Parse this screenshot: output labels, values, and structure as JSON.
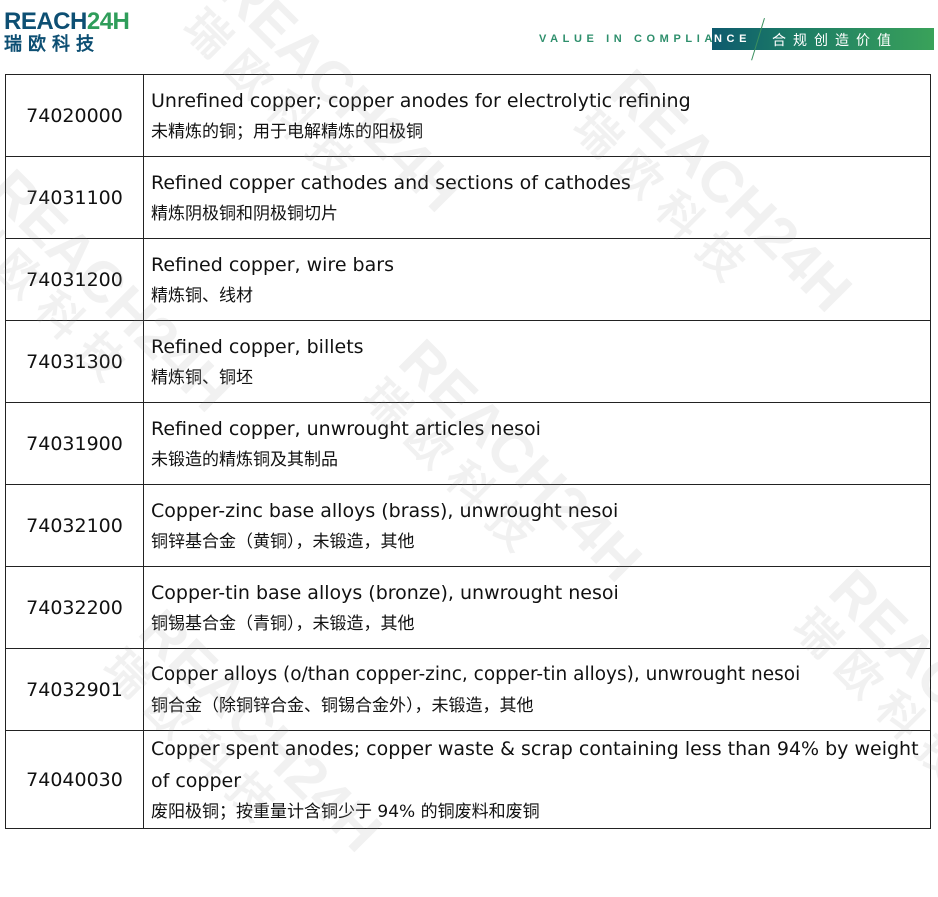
{
  "header": {
    "logo_en_part1": "REACH",
    "logo_en_part2": "24H",
    "logo_cn": "瑞欧科技",
    "tagline_main": "VALUE IN COMPLIA",
    "tagline_tail": "NCE",
    "slogan_cn": "合规创造价值",
    "colors": {
      "brand_blue": "#0d4f73",
      "brand_green": "#2f9d5a",
      "bar_start": "#0e5a6e",
      "bar_end": "#3aa25a"
    }
  },
  "watermark": {
    "text_en": "REACH24H",
    "text_cn": "瑞欧科技"
  },
  "table": {
    "rows": [
      {
        "code": "74020000",
        "en": "Unrefined copper; copper anodes for electrolytic refining",
        "zh": "未精炼的铜；用于电解精炼的阳极铜"
      },
      {
        "code": "74031100",
        "en": "Refined copper cathodes and sections of cathodes",
        "zh": "精炼阴极铜和阴极铜切片"
      },
      {
        "code": "74031200",
        "en": "Refined copper, wire bars",
        "zh": "精炼铜、线材"
      },
      {
        "code": "74031300",
        "en": "Refined copper, billets",
        "zh": "精炼铜、铜坯"
      },
      {
        "code": "74031900",
        "en": "Refined copper, unwrought articles nesoi",
        "zh": "未锻造的精炼铜及其制品"
      },
      {
        "code": "74032100",
        "en": "Copper-zinc base alloys (brass), unwrought nesoi",
        "zh": "铜锌基合金（黄铜），未锻造，其他"
      },
      {
        "code": "74032200",
        "en": "Copper-tin base alloys (bronze), unwrought nesoi",
        "zh": "铜锡基合金（青铜），未锻造，其他"
      },
      {
        "code": "74032901",
        "en": "Copper alloys (o/than copper-zinc, copper-tin alloys), unwrought nesoi",
        "zh": "铜合金（除铜锌合金、铜锡合金外），未锻造，其他"
      },
      {
        "code": "74040030",
        "en": "Copper spent anodes; copper waste & scrap containing less than 94% by weight of copper",
        "zh": "废阳极铜；按重量计含铜少于 94% 的铜废料和废铜"
      }
    ]
  }
}
